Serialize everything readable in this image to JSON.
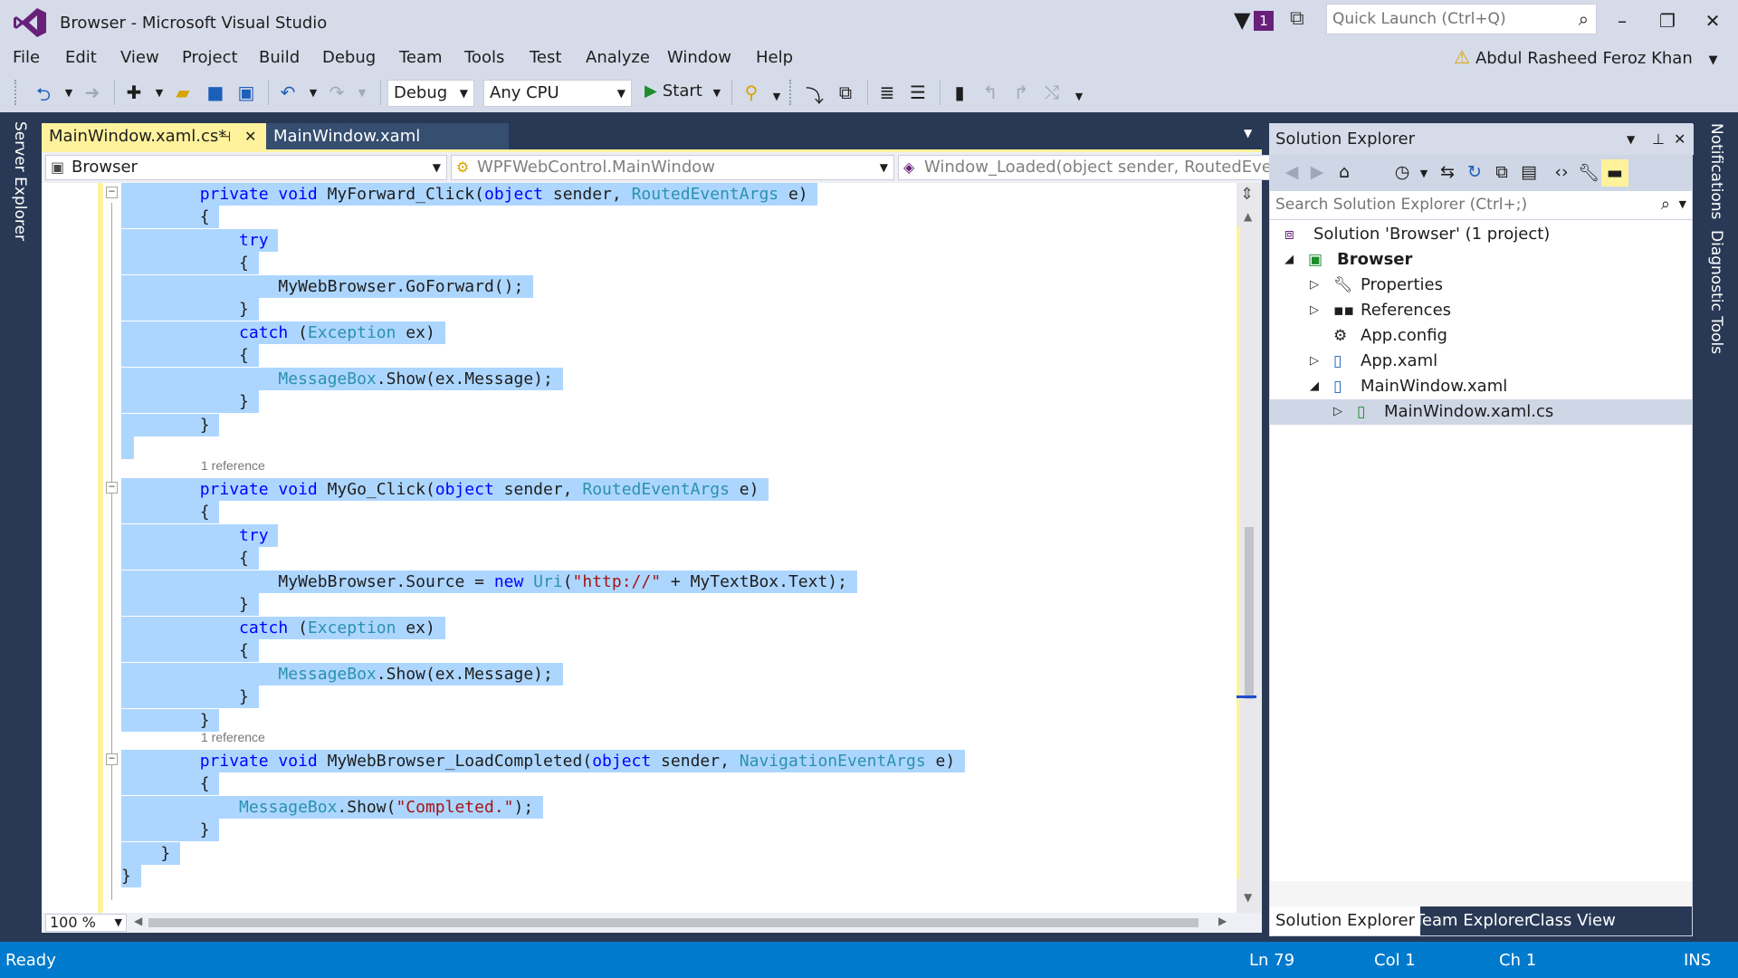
{
  "window": {
    "title": "Browser - Microsoft Visual Studio",
    "notification_count": "1",
    "quick_launch_placeholder": "Quick Launch (Ctrl+Q)",
    "minimize": "–",
    "restore": "❐",
    "close": "✕"
  },
  "menu": [
    "File",
    "Edit",
    "View",
    "Project",
    "Build",
    "Debug",
    "Team",
    "Tools",
    "Test",
    "Analyze",
    "Window",
    "Help"
  ],
  "user": {
    "name": "Abdul Rasheed Feroz Khan"
  },
  "toolbar": {
    "config": "Debug",
    "platform": "Any CPU",
    "start_label": "Start"
  },
  "side_tabs": {
    "left": "Server Explorer",
    "right_notifications": "Notifications",
    "right_diagnostic": "Diagnostic Tools"
  },
  "doc_tabs": [
    {
      "label": "MainWindow.xaml.cs*",
      "pin": "⊣",
      "close": "✕"
    },
    {
      "label": "MainWindow.xaml"
    }
  ],
  "navbar": {
    "project": "Browser",
    "type": "WPFWebControl.MainWindow",
    "member": "Window_Loaded(object sender, RoutedEventArgs"
  },
  "code": {
    "ref1": "1 reference",
    "ref2": "1 reference",
    "lines": [
      "        private void MyForward_Click(object sender, RoutedEventArgs e)",
      "        {",
      "            try",
      "            {",
      "                MyWebBrowser.GoForward();",
      "            }",
      "            catch (Exception ex)",
      "            {",
      "                MessageBox.Show(ex.Message);",
      "            }",
      "        }",
      "",
      "        private void MyGo_Click(object sender, RoutedEventArgs e)",
      "        {",
      "            try",
      "            {",
      "                MyWebBrowser.Source = new Uri(\"http://\" + MyTextBox.Text);",
      "            }",
      "            catch (Exception ex)",
      "            {",
      "                MessageBox.Show(ex.Message);",
      "            }",
      "        }",
      "        private void MyWebBrowser_LoadCompleted(object sender, NavigationEventArgs e)",
      "        {",
      "            MessageBox.Show(\"Completed.\");",
      "        }",
      "    }",
      "}"
    ]
  },
  "editor": {
    "zoom": "100 %"
  },
  "solution_explorer": {
    "title": "Solution Explorer",
    "search_placeholder": "Search Solution Explorer (Ctrl+;)",
    "items": [
      {
        "label": "Solution 'Browser' (1 project)",
        "icon": "solution-icon"
      },
      {
        "label": "Browser",
        "icon": "csharp-project-icon"
      },
      {
        "label": "Properties",
        "icon": "wrench-icon"
      },
      {
        "label": "References",
        "icon": "references-icon"
      },
      {
        "label": "App.config",
        "icon": "config-icon"
      },
      {
        "label": "App.xaml",
        "icon": "xaml-icon"
      },
      {
        "label": "MainWindow.xaml",
        "icon": "xaml-icon"
      },
      {
        "label": "MainWindow.xaml.cs",
        "icon": "cs-file-icon"
      }
    ],
    "tabs": [
      "Solution Explorer",
      "Team Explorer",
      "Class View"
    ]
  },
  "status": {
    "state": "Ready",
    "line": "Ln 79",
    "col": "Col 1",
    "ch": "Ch 1",
    "mode": "INS"
  },
  "colors": {
    "accent": "#007acc",
    "vs_purple": "#68217a",
    "selection": "#add6ff",
    "keyword": "#0000ff",
    "type": "#2b91af",
    "string": "#a31515",
    "chrome": "#d6dbe9",
    "frame": "#293955"
  }
}
